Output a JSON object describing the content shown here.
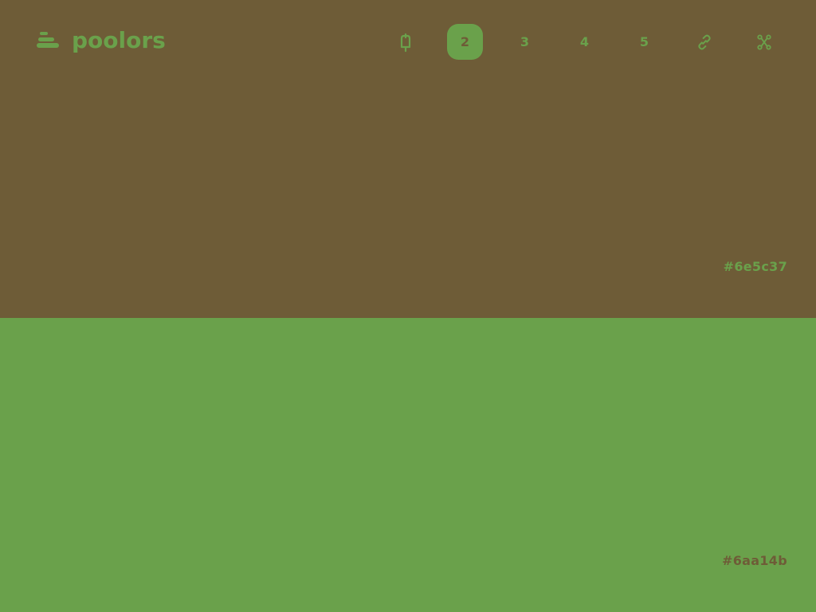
{
  "brand": {
    "name": "poolors",
    "icon": "stack-icon"
  },
  "nav": {
    "items": [
      {
        "type": "icon",
        "icon": "popsicle-icon"
      },
      {
        "type": "number",
        "label": "2",
        "active": true
      },
      {
        "type": "number",
        "label": "3"
      },
      {
        "type": "number",
        "label": "4"
      },
      {
        "type": "number",
        "label": "5"
      },
      {
        "type": "icon",
        "icon": "link-icon"
      },
      {
        "type": "icon",
        "icon": "figma-icon"
      }
    ]
  },
  "palette": {
    "colors": [
      {
        "hex": "#6e5c37"
      },
      {
        "hex": "#6aa14b"
      }
    ]
  }
}
